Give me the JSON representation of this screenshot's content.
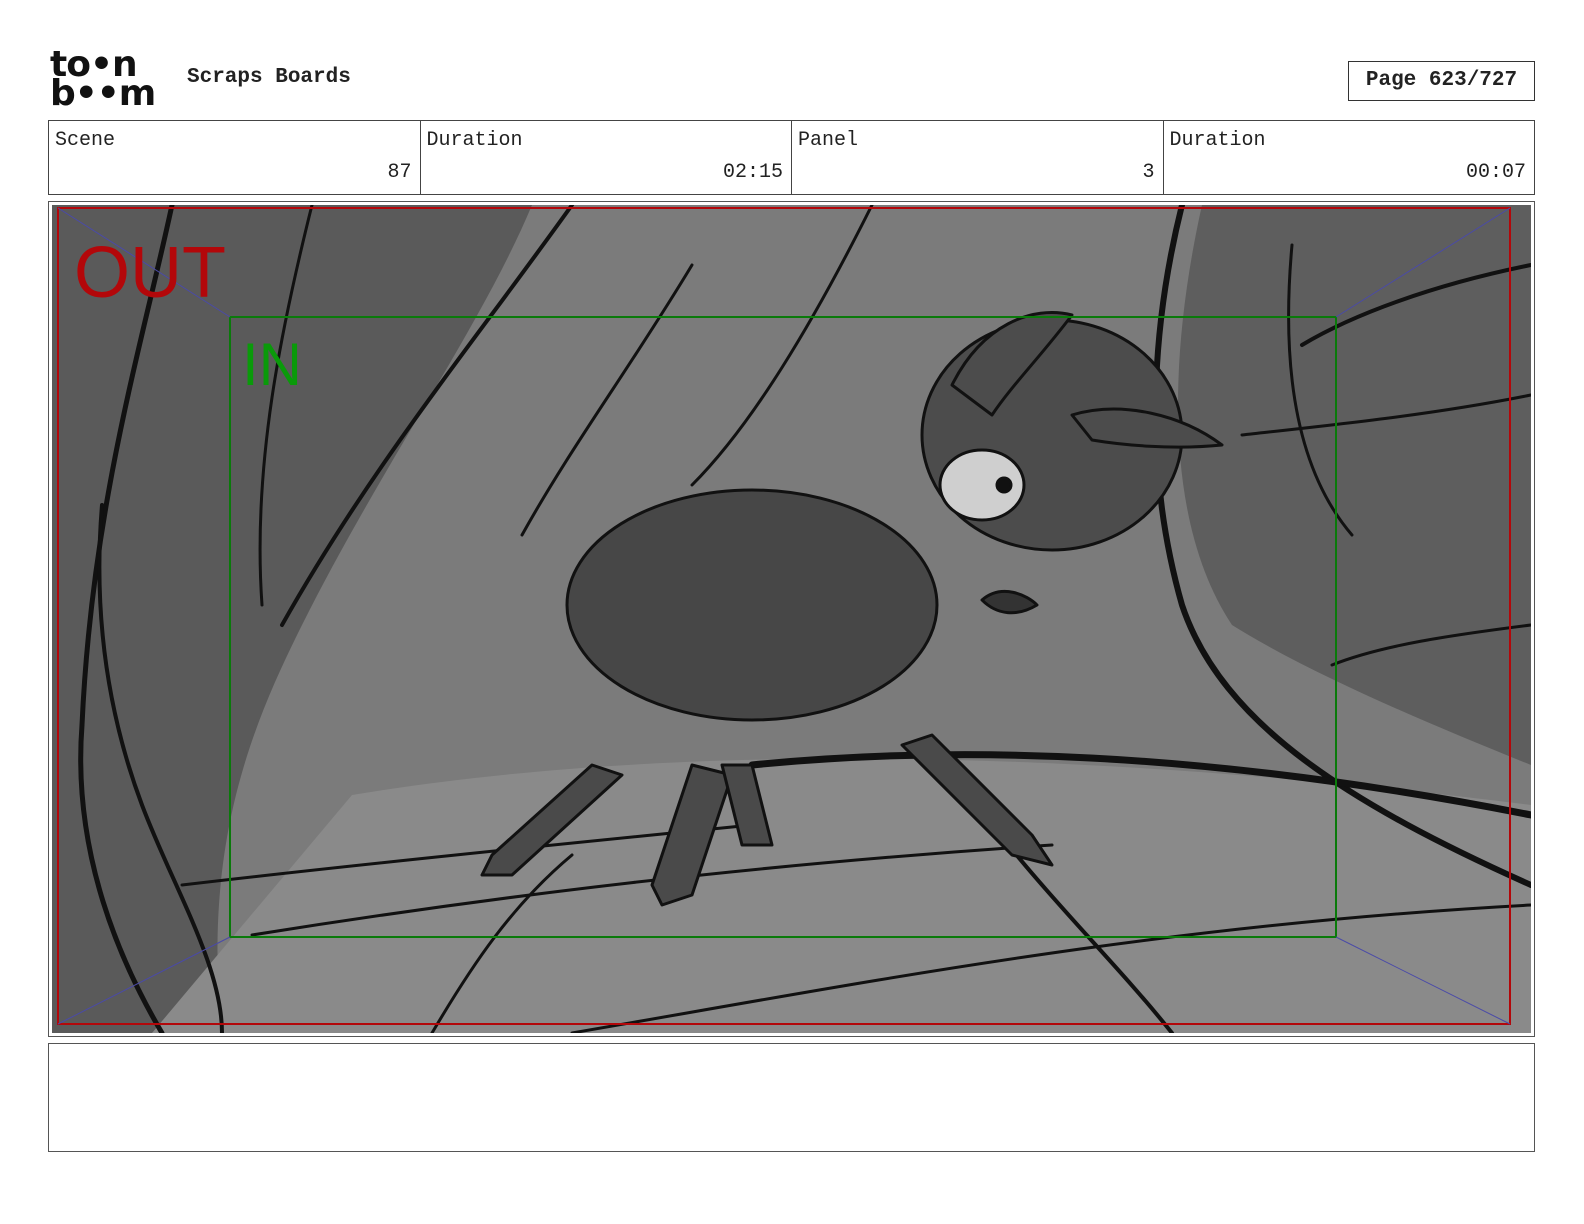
{
  "header": {
    "logo_line1": "to•n",
    "logo_line2": "b••m",
    "title": "Scraps Boards",
    "page": "Page 623/727"
  },
  "info": {
    "scene_label": "Scene",
    "scene_value": "87",
    "scene_duration_label": "Duration",
    "scene_duration_value": "02:15",
    "panel_label": "Panel",
    "panel_value": "3",
    "panel_duration_label": "Duration",
    "panel_duration_value": "00:07"
  },
  "panel": {
    "out_label": "OUT",
    "in_label": "IN",
    "colors": {
      "out_frame": "#b3070a",
      "in_frame": "#0a7a0a",
      "diagonal": "#4a4aa8",
      "background": "#7a7a7a"
    }
  },
  "notes": {
    "text": ""
  }
}
